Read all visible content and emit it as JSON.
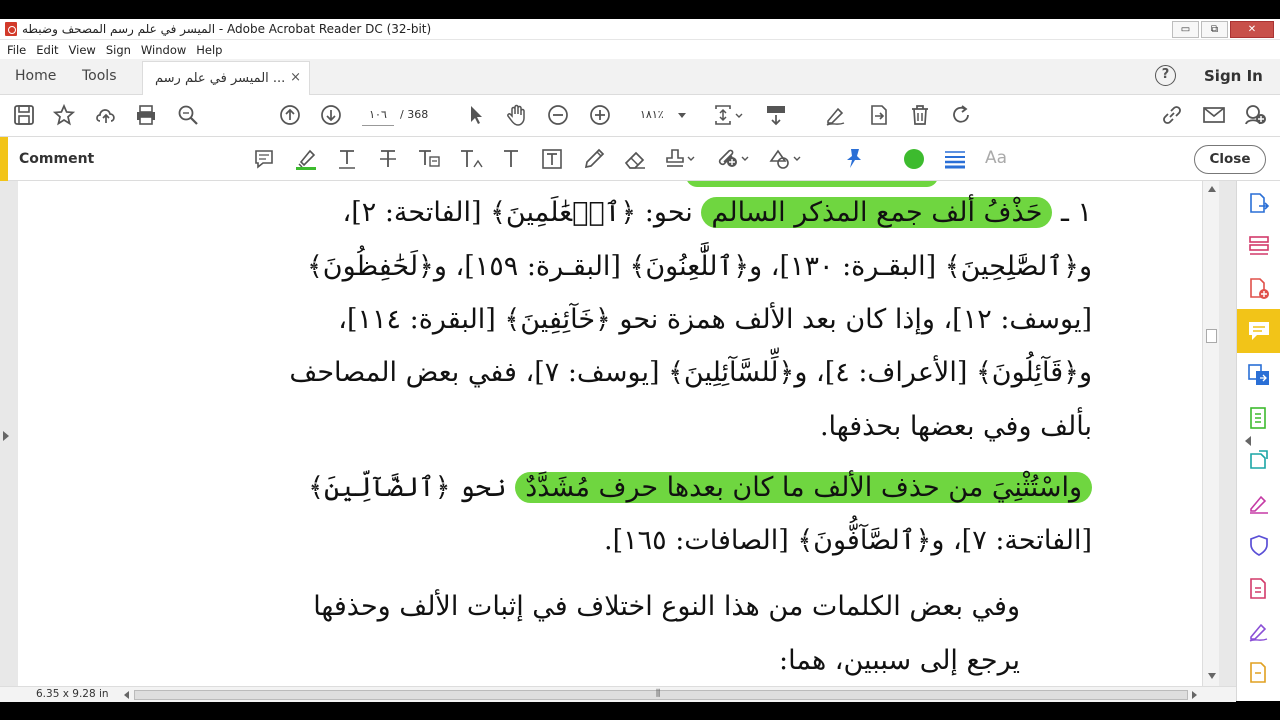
{
  "window": {
    "title": "الميسر في علم رسم المصحف وضبطه - Adobe Acrobat Reader DC (32-bit)",
    "controls": {
      "minimize": "▭",
      "restore": "⧉",
      "close": "✕"
    }
  },
  "menu": [
    "File",
    "Edit",
    "View",
    "Sign",
    "Window",
    "Help"
  ],
  "tabs": {
    "home": "Home",
    "tools": "Tools",
    "document": "الميسر في علم رسم ...",
    "document_close": "×"
  },
  "header": {
    "help": "?",
    "sign_in": "Sign In"
  },
  "toolbar": {
    "current_page": "١٠٦",
    "total_pages": "/  368",
    "zoom": "١٨١٪"
  },
  "comment_bar": {
    "label": "Comment",
    "close": "Close",
    "text_style": "Aa",
    "colors": {
      "accent": "#f2c418",
      "highlight": "#6fd640",
      "active_color": "#3dbb2e",
      "pin": "#2a6fd6"
    }
  },
  "document": {
    "lines": [
      "١ ـ حَذْفُ ألف جمع المذكر السالم نحو: ﴿ٱلۡعَٰلَمِينَ﴾ [الفاتحة: ٢]،",
      "و﴿ٱلصَّٰلِحِينَ﴾ [البقـرة: ١٣٠]، و﴿ٱللَّٰعِنُونَ﴾ [البقـرة: ١٥٩]، و﴿لَحَٰفِظُونَ﴾",
      "[يوسف: ١٢]، وإذا كان بعد الألف همزة نحو ﴿خَآئِفِينَ﴾ [البقرة: ١١٤]،",
      "و﴿قَآئِلُونَ﴾ [الأعراف: ٤]، و﴿لِّلسَّآئِلِينَ﴾ [يوسف: ٧]، ففي بعض المصاحف",
      "بألف وفي بعضها بحذفها.",
      "واسْتُثْنِيَ من حذف الألف ما كان بعدها حرف مُشَدَّدٌ نحو ﴿ٱلضَّآلِّينَ﴾",
      "[الفاتحة: ٧]، و﴿ٱلصَّآفُّونَ﴾ [الصافات: ١٦٥].",
      "وفي بعض الكلمات من هذا النوع اختلاف في إثبات الألف وحذفها",
      "يرجع إلى سببين، هما:"
    ],
    "highlights": [
      "حَذْفُ ألف جمع المذكر السالم",
      "واسْتُثْنِيَ من حذف الألف ما كان بعدها حرف مُشَدَّدٌ"
    ]
  },
  "status": {
    "page_size": "6.35 x 9.28 in",
    "grip": "⫼"
  }
}
